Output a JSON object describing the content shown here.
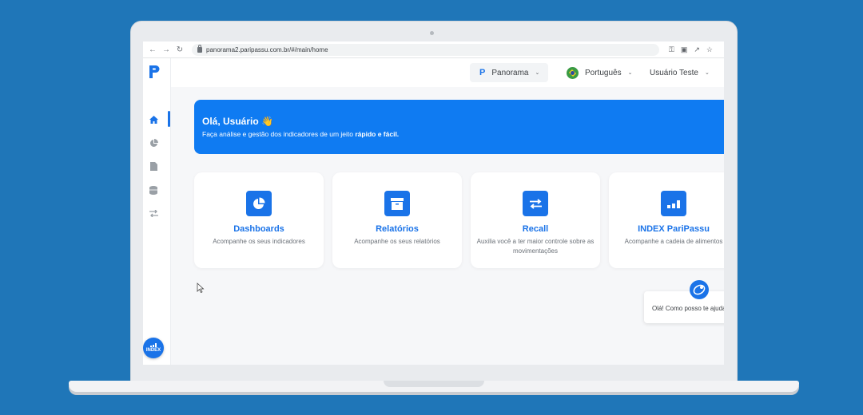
{
  "browser": {
    "url": "panorama2.paripassu.com.br/#/main/home"
  },
  "header": {
    "product_select": "Panorama",
    "language": "Português",
    "user_menu": "Usuário Teste"
  },
  "banner": {
    "title": "Olá, Usuário 👋",
    "subtitle_prefix": "Faça análise e gestão dos indicadores de um jeito ",
    "subtitle_bold": "rápido e fácil."
  },
  "cards": [
    {
      "title": "Dashboards",
      "description": "Acompanhe os seus indicadores",
      "icon": "pie-chart-icon"
    },
    {
      "title": "Relatórios",
      "description": "Acompanhe os seus relatórios",
      "icon": "archive-box-icon"
    },
    {
      "title": "Recall",
      "description": "Auxilia você a ter maior controle sobre as movimentações",
      "icon": "swap-arrows-icon"
    },
    {
      "title": "INDEX PariPassu",
      "description": "Acompanhe a cadeia de alimentos",
      "icon": "bar-chart-icon"
    }
  ],
  "sidebar": {
    "items": [
      "home-icon",
      "pie-chart-icon",
      "document-icon",
      "database-icon",
      "swap-icon"
    ],
    "active": "home-icon",
    "index_badge": "INDEX"
  },
  "chat": {
    "greeting": "Olá! Como posso te ajudar?"
  },
  "colors": {
    "background": "#1f76b8",
    "accent": "#1a73e8",
    "banner": "#0f7bf2"
  }
}
